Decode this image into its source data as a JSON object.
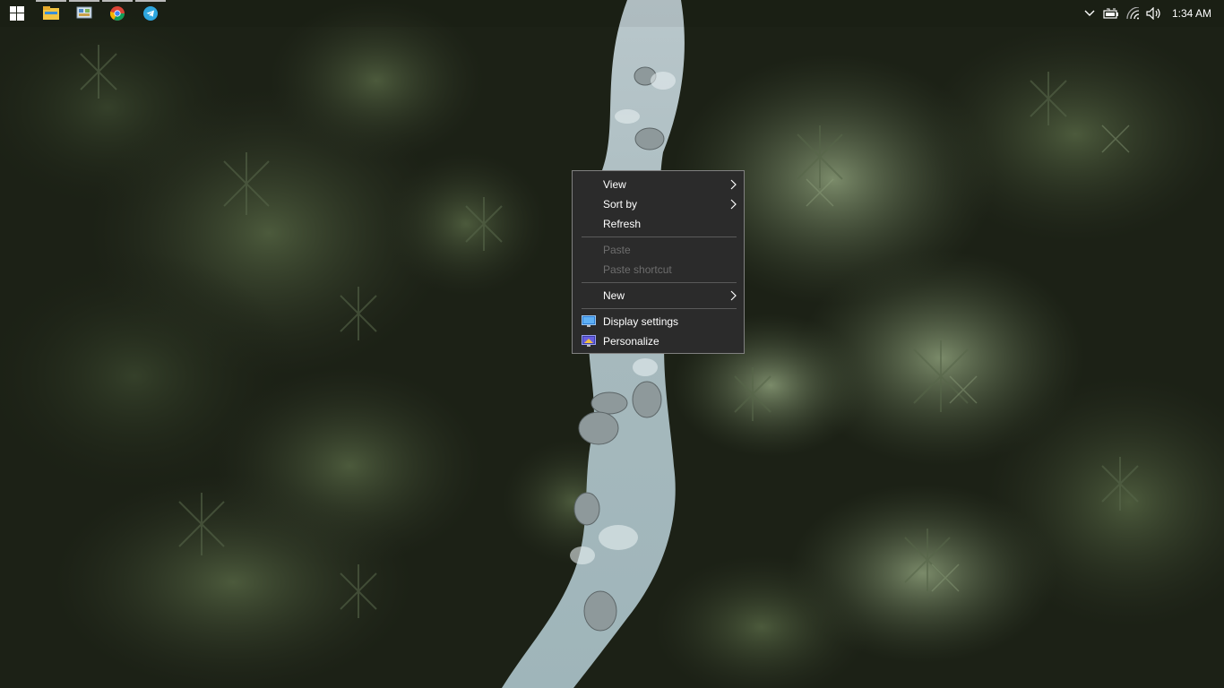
{
  "taskbar": {
    "start_icon": "windows-logo-icon",
    "pinned": [
      {
        "name": "file-explorer",
        "icon": "folder-icon"
      },
      {
        "name": "control-panel",
        "icon": "control-panel-icon"
      },
      {
        "name": "chrome",
        "icon": "chrome-icon"
      },
      {
        "name": "telegram",
        "icon": "telegram-icon"
      }
    ],
    "tray": {
      "icons": [
        "chevron-up-icon",
        "battery-icon",
        "wifi-icon",
        "volume-icon"
      ],
      "time": "1:34 AM"
    }
  },
  "context_menu": {
    "items": [
      {
        "label": "View",
        "submenu": true,
        "enabled": true
      },
      {
        "label": "Sort by",
        "submenu": true,
        "enabled": true
      },
      {
        "label": "Refresh",
        "submenu": false,
        "enabled": true
      },
      {
        "label": "Paste",
        "submenu": false,
        "enabled": false
      },
      {
        "label": "Paste shortcut",
        "submenu": false,
        "enabled": false
      },
      {
        "label": "New",
        "submenu": true,
        "enabled": true
      },
      {
        "label": "Display settings",
        "submenu": false,
        "enabled": true,
        "icon": "display-settings-icon"
      },
      {
        "label": "Personalize",
        "submenu": false,
        "enabled": true,
        "icon": "personalize-icon"
      }
    ]
  },
  "colors": {
    "menu_bg": "#2b2b2b",
    "menu_border": "#808080",
    "disabled_text": "#6d6d6d"
  }
}
